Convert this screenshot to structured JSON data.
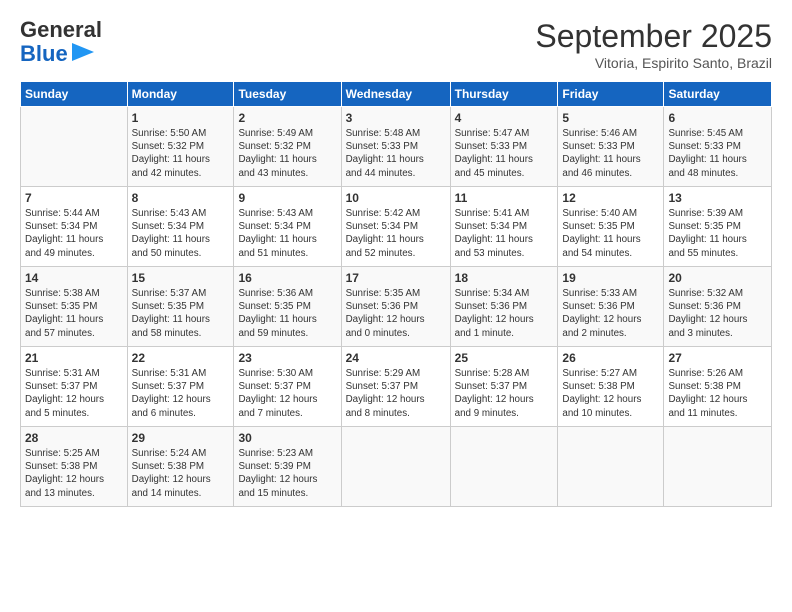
{
  "logo": {
    "line1": "General",
    "line2": "Blue",
    "arrow": true
  },
  "title": "September 2025",
  "location": "Vitoria, Espirito Santo, Brazil",
  "headers": [
    "Sunday",
    "Monday",
    "Tuesday",
    "Wednesday",
    "Thursday",
    "Friday",
    "Saturday"
  ],
  "weeks": [
    [
      {
        "day": "",
        "info": ""
      },
      {
        "day": "1",
        "info": "Sunrise: 5:50 AM\nSunset: 5:32 PM\nDaylight: 11 hours\nand 42 minutes."
      },
      {
        "day": "2",
        "info": "Sunrise: 5:49 AM\nSunset: 5:32 PM\nDaylight: 11 hours\nand 43 minutes."
      },
      {
        "day": "3",
        "info": "Sunrise: 5:48 AM\nSunset: 5:33 PM\nDaylight: 11 hours\nand 44 minutes."
      },
      {
        "day": "4",
        "info": "Sunrise: 5:47 AM\nSunset: 5:33 PM\nDaylight: 11 hours\nand 45 minutes."
      },
      {
        "day": "5",
        "info": "Sunrise: 5:46 AM\nSunset: 5:33 PM\nDaylight: 11 hours\nand 46 minutes."
      },
      {
        "day": "6",
        "info": "Sunrise: 5:45 AM\nSunset: 5:33 PM\nDaylight: 11 hours\nand 48 minutes."
      }
    ],
    [
      {
        "day": "7",
        "info": "Sunrise: 5:44 AM\nSunset: 5:34 PM\nDaylight: 11 hours\nand 49 minutes."
      },
      {
        "day": "8",
        "info": "Sunrise: 5:43 AM\nSunset: 5:34 PM\nDaylight: 11 hours\nand 50 minutes."
      },
      {
        "day": "9",
        "info": "Sunrise: 5:43 AM\nSunset: 5:34 PM\nDaylight: 11 hours\nand 51 minutes."
      },
      {
        "day": "10",
        "info": "Sunrise: 5:42 AM\nSunset: 5:34 PM\nDaylight: 11 hours\nand 52 minutes."
      },
      {
        "day": "11",
        "info": "Sunrise: 5:41 AM\nSunset: 5:34 PM\nDaylight: 11 hours\nand 53 minutes."
      },
      {
        "day": "12",
        "info": "Sunrise: 5:40 AM\nSunset: 5:35 PM\nDaylight: 11 hours\nand 54 minutes."
      },
      {
        "day": "13",
        "info": "Sunrise: 5:39 AM\nSunset: 5:35 PM\nDaylight: 11 hours\nand 55 minutes."
      }
    ],
    [
      {
        "day": "14",
        "info": "Sunrise: 5:38 AM\nSunset: 5:35 PM\nDaylight: 11 hours\nand 57 minutes."
      },
      {
        "day": "15",
        "info": "Sunrise: 5:37 AM\nSunset: 5:35 PM\nDaylight: 11 hours\nand 58 minutes."
      },
      {
        "day": "16",
        "info": "Sunrise: 5:36 AM\nSunset: 5:35 PM\nDaylight: 11 hours\nand 59 minutes."
      },
      {
        "day": "17",
        "info": "Sunrise: 5:35 AM\nSunset: 5:36 PM\nDaylight: 12 hours\nand 0 minutes."
      },
      {
        "day": "18",
        "info": "Sunrise: 5:34 AM\nSunset: 5:36 PM\nDaylight: 12 hours\nand 1 minute."
      },
      {
        "day": "19",
        "info": "Sunrise: 5:33 AM\nSunset: 5:36 PM\nDaylight: 12 hours\nand 2 minutes."
      },
      {
        "day": "20",
        "info": "Sunrise: 5:32 AM\nSunset: 5:36 PM\nDaylight: 12 hours\nand 3 minutes."
      }
    ],
    [
      {
        "day": "21",
        "info": "Sunrise: 5:31 AM\nSunset: 5:37 PM\nDaylight: 12 hours\nand 5 minutes."
      },
      {
        "day": "22",
        "info": "Sunrise: 5:31 AM\nSunset: 5:37 PM\nDaylight: 12 hours\nand 6 minutes."
      },
      {
        "day": "23",
        "info": "Sunrise: 5:30 AM\nSunset: 5:37 PM\nDaylight: 12 hours\nand 7 minutes."
      },
      {
        "day": "24",
        "info": "Sunrise: 5:29 AM\nSunset: 5:37 PM\nDaylight: 12 hours\nand 8 minutes."
      },
      {
        "day": "25",
        "info": "Sunrise: 5:28 AM\nSunset: 5:37 PM\nDaylight: 12 hours\nand 9 minutes."
      },
      {
        "day": "26",
        "info": "Sunrise: 5:27 AM\nSunset: 5:38 PM\nDaylight: 12 hours\nand 10 minutes."
      },
      {
        "day": "27",
        "info": "Sunrise: 5:26 AM\nSunset: 5:38 PM\nDaylight: 12 hours\nand 11 minutes."
      }
    ],
    [
      {
        "day": "28",
        "info": "Sunrise: 5:25 AM\nSunset: 5:38 PM\nDaylight: 12 hours\nand 13 minutes."
      },
      {
        "day": "29",
        "info": "Sunrise: 5:24 AM\nSunset: 5:38 PM\nDaylight: 12 hours\nand 14 minutes."
      },
      {
        "day": "30",
        "info": "Sunrise: 5:23 AM\nSunset: 5:39 PM\nDaylight: 12 hours\nand 15 minutes."
      },
      {
        "day": "",
        "info": ""
      },
      {
        "day": "",
        "info": ""
      },
      {
        "day": "",
        "info": ""
      },
      {
        "day": "",
        "info": ""
      }
    ]
  ]
}
